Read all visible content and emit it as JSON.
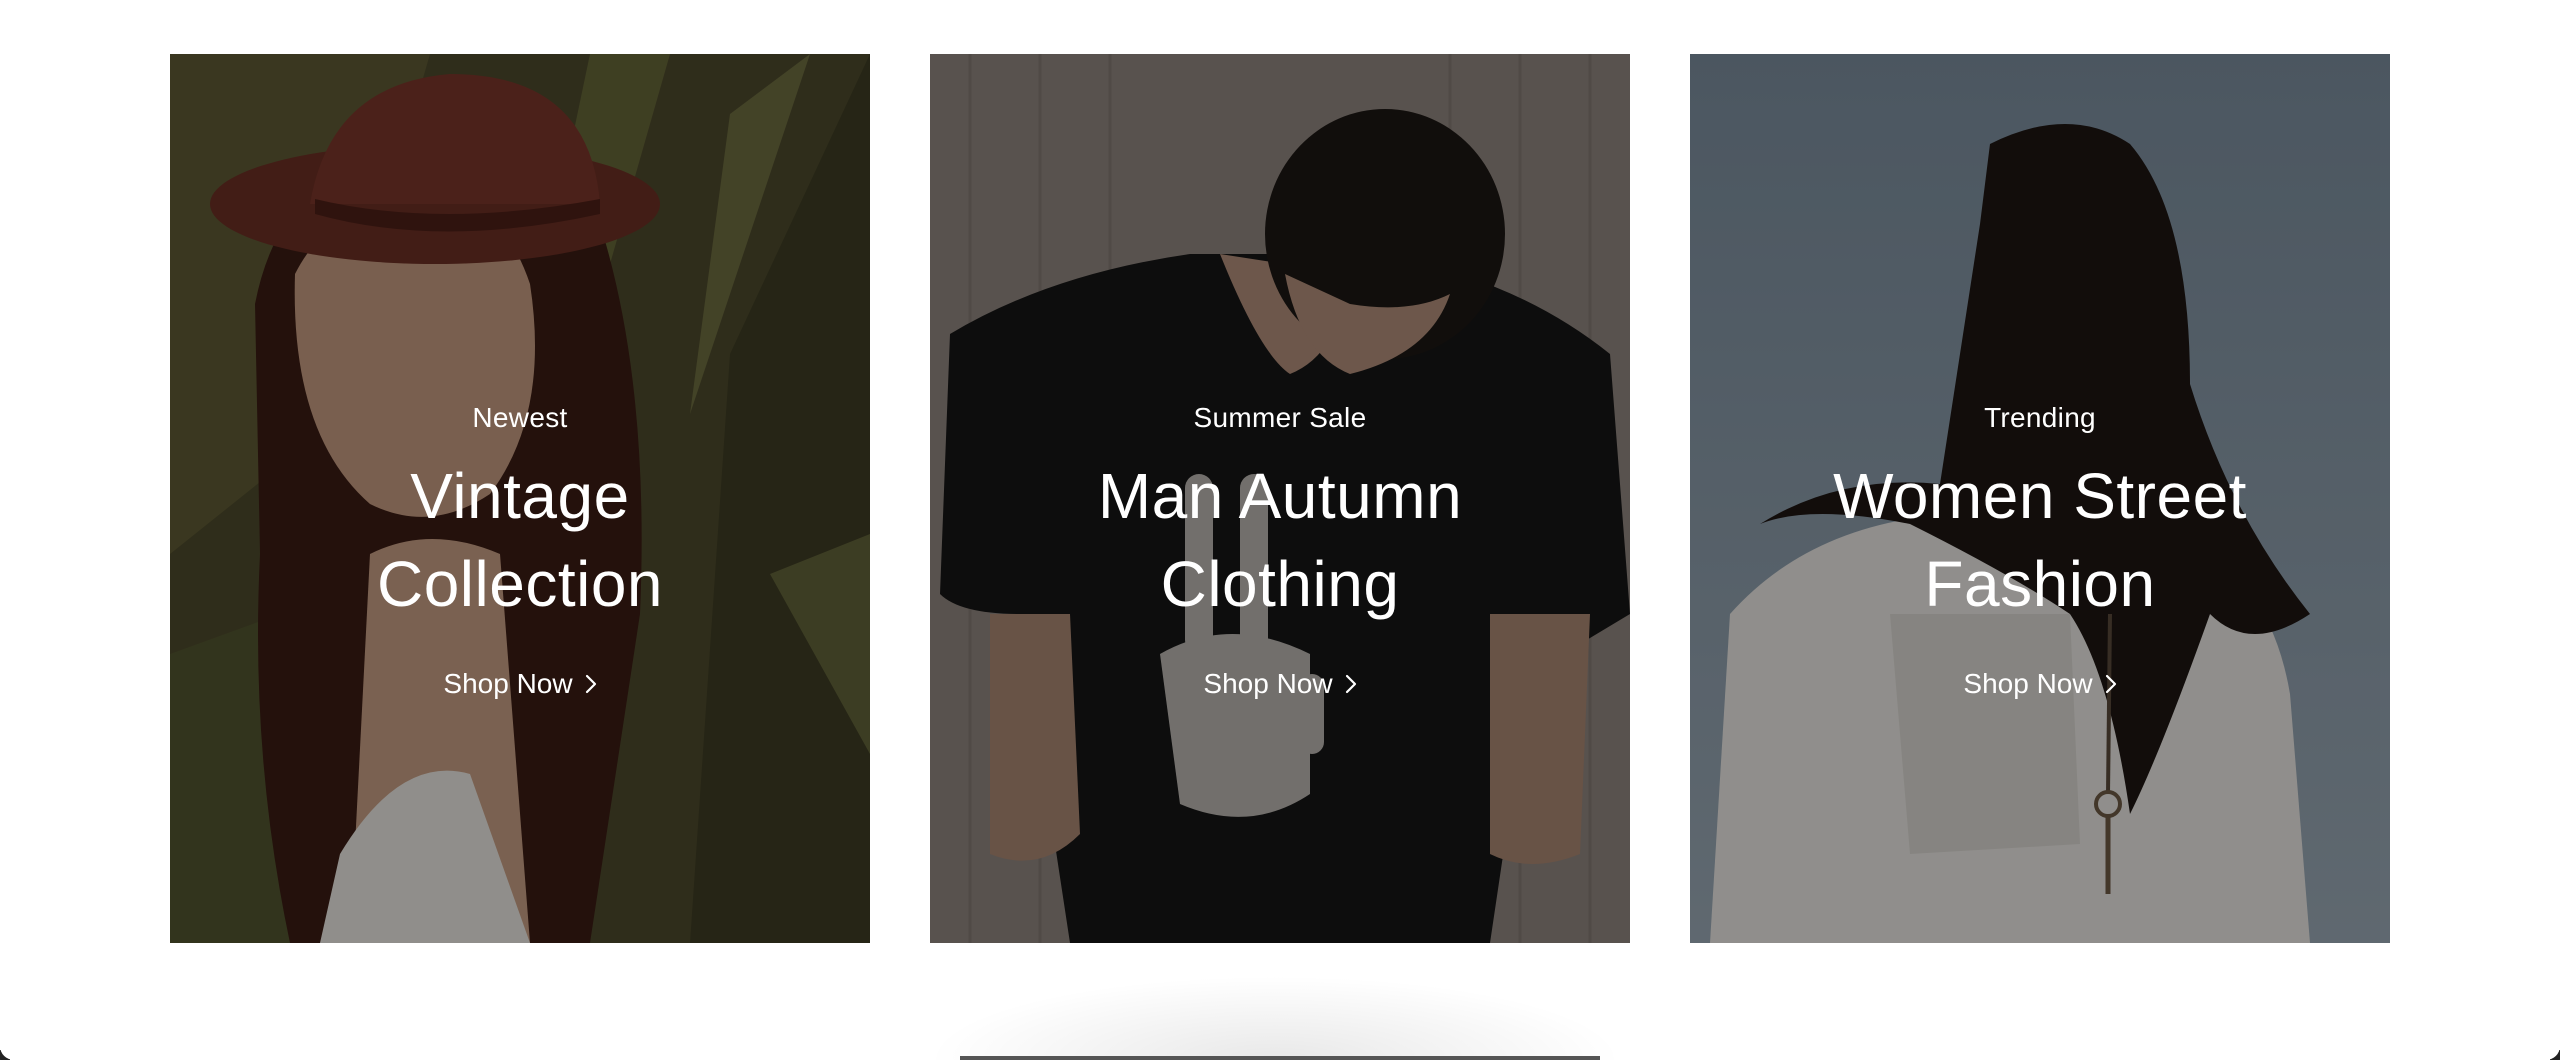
{
  "cards": [
    {
      "eyebrow": "Newest",
      "title_line1": "Vintage",
      "title_line2": "Collection",
      "cta": "Shop Now",
      "image": "woman-in-hat-among-leaves-photo"
    },
    {
      "eyebrow": "Summer Sale",
      "title_line1": "Man Autumn",
      "title_line2": "Clothing",
      "cta": "Shop Now",
      "image": "man-in-black-skeleton-hand-tshirt-photo"
    },
    {
      "eyebrow": "Trending",
      "title_line1": "Women Street",
      "title_line2": "Fashion",
      "cta": "Shop Now",
      "image": "woman-with-windblown-hair-photo"
    }
  ],
  "icons": {
    "cta_arrow": "chevron-right-icon"
  },
  "colors": {
    "text": "#ffffff",
    "overlay": "rgba(0,0,0,0.38)",
    "page_bg": "#ffffff"
  }
}
